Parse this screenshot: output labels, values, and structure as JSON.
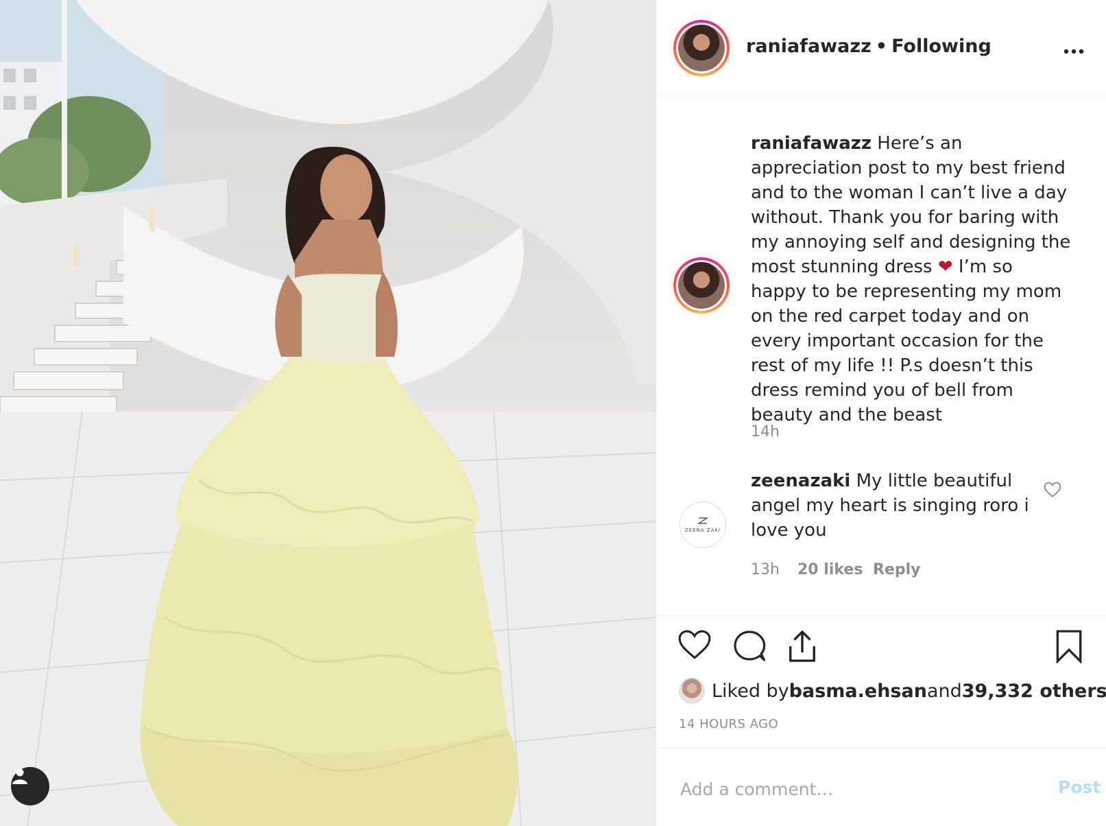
{
  "post": {
    "username": "raniafawazz",
    "separator": "•",
    "follow_status": "Following",
    "more_icon": "ellipsis-icon"
  },
  "caption": {
    "username": "raniafawazz",
    "text_before_emoji": " Here’s an appreciation post to my best friend and to the woman I can’t live a day without. Thank you for baring with my annoying self and designing the most stunning dress ",
    "emoji": "❤",
    "text_after_emoji": " I’m so happy to be representing my mom on the red carpet today and on every important occasion for the rest of my life !! P.s doesn’t this dress remind you of bell from beauty and the beast",
    "time": "14h"
  },
  "comment": {
    "username": "zeenazaki",
    "text": " My little beautiful angel my heart is singing roro i love you",
    "avatar_text": "ZEENA ZAKI",
    "time": "13h",
    "likes": "20 likes",
    "reply": "Reply"
  },
  "likes": {
    "prefix": "Liked by ",
    "user": "basma.ehsan",
    "middle": " and ",
    "count": "39,332 others"
  },
  "timestamp": "14 HOURS AGO",
  "add_comment": {
    "placeholder": "Add a comment…",
    "post_label": "Post"
  },
  "colors": {
    "link_disabled": "#b2dffc",
    "muted": "#8e8e8e",
    "text": "#262626",
    "emoji_heart": "#c0142f"
  }
}
